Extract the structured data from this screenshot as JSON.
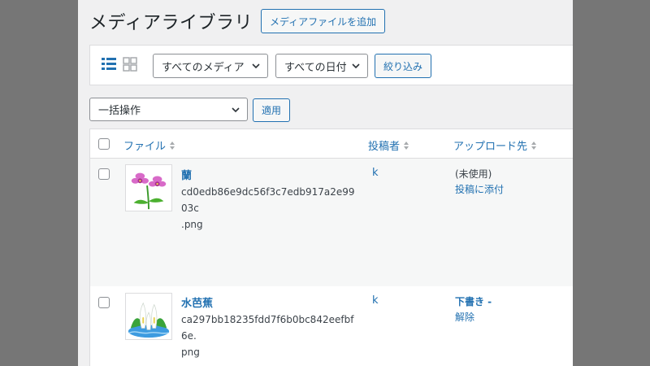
{
  "header": {
    "title": "メディアライブラリ",
    "add_button": "メディアファイルを追加"
  },
  "filters": {
    "media_type": "すべてのメディア",
    "date": "すべての日付",
    "filter_button": "絞り込み",
    "icons": [
      "list-view-icon",
      "grid-view-icon"
    ]
  },
  "bulk": {
    "action": "一括操作",
    "apply_button": "適用"
  },
  "table": {
    "columns": {
      "file": "ファイル",
      "author": "投稿者",
      "uploaded_to": "アップロード先"
    },
    "rows": [
      {
        "title": "蘭",
        "filename_line1": "cd0edb86e9dc56f3c7edb917a2e9903c",
        "filename_line2": ".png",
        "author": "k",
        "uploaded_line1": "(未使用)",
        "uploaded_line2": "投稿に添付"
      },
      {
        "title": "水芭蕉",
        "filename_line1": "ca297bb18235fdd7f6b0bc842eefbf6e.",
        "filename_line2": "png",
        "author": "k",
        "uploaded_line1": "下書き -",
        "uploaded_line2": "解除"
      }
    ]
  },
  "colors": {
    "accent": "#2271b1",
    "background": "#f0f0f1",
    "outer": "#767676"
  }
}
